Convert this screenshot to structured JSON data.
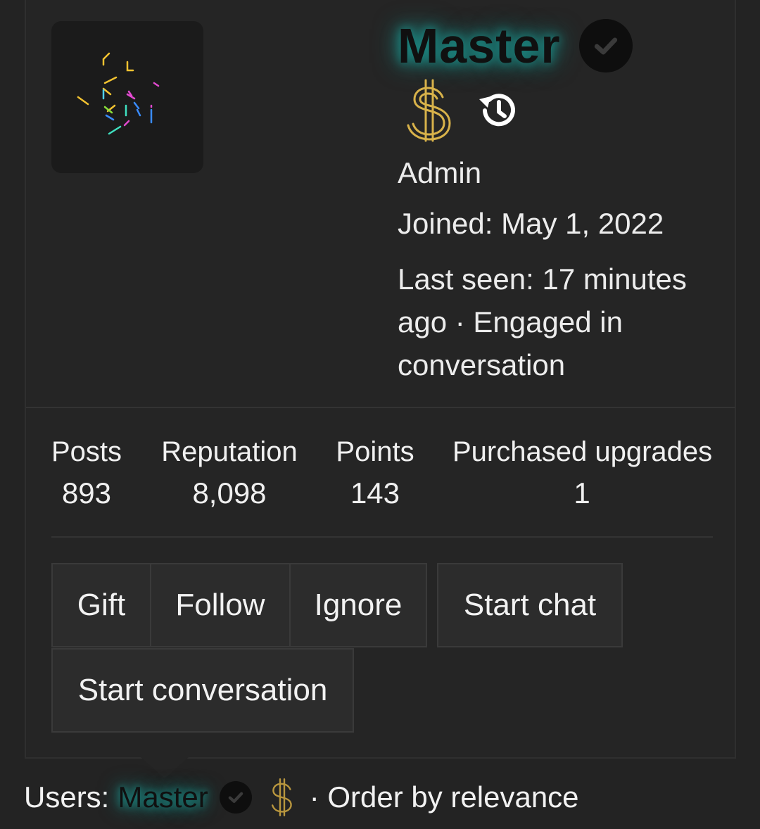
{
  "profile": {
    "username": "Master",
    "role": "Admin",
    "joined": "Joined: May 1, 2022",
    "last_seen": "Last seen: 17 minutes ago · Engaged in conversation",
    "icons": [
      "verified-check-icon",
      "dollar-badge-icon",
      "history-icon"
    ]
  },
  "stats": [
    {
      "label": "Posts",
      "value": "893"
    },
    {
      "label": "Reputation",
      "value": "8,098"
    },
    {
      "label": "Points",
      "value": "143"
    },
    {
      "label": "Purchased upgrades",
      "value": "1"
    }
  ],
  "actions": {
    "gift": "Gift",
    "follow": "Follow",
    "ignore": "Ignore",
    "start_chat": "Start chat",
    "start_conversation": "Start conversation"
  },
  "footer": {
    "prefix": "Users:",
    "username": "Master",
    "order": "· Order by relevance"
  },
  "colors": {
    "background": "#232323",
    "name_glow": "#1b8a84",
    "gold": "#d8b24a"
  }
}
